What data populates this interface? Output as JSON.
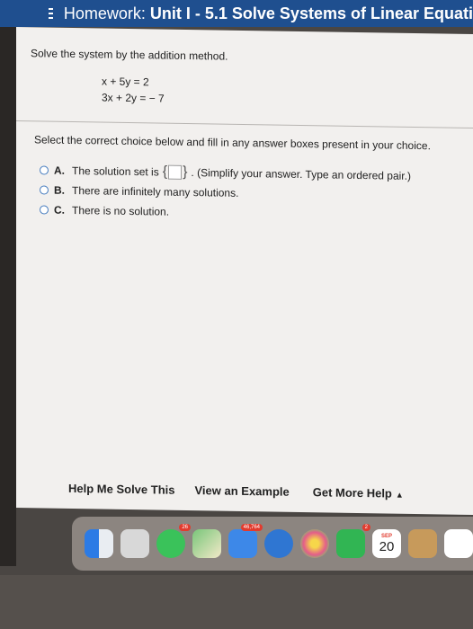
{
  "header": {
    "menu_icon": "hamburger-menu-icon",
    "title_prefix": "Homework: ",
    "title_rest": "Unit I - 5.1 Solve Systems of Linear Equati"
  },
  "question": {
    "prompt": "Solve the system by the addition method.",
    "equations": [
      "x + 5y  =  2",
      "3x + 2y  =  − 7"
    ]
  },
  "instruction": "Select the correct choice below and fill in any answer boxes present in your choice.",
  "choices": [
    {
      "letter": "A.",
      "text_before": "The solution set is",
      "text_after": ". (Simplify your answer. Type an ordered pair.)"
    },
    {
      "letter": "B.",
      "text": "There are infinitely many solutions."
    },
    {
      "letter": "C.",
      "text": "There is no solution."
    }
  ],
  "help_buttons": {
    "help_me_solve": "Help Me Solve This",
    "view_example": "View an Example",
    "get_more_help": "Get More Help",
    "caret": "▲"
  },
  "dock": {
    "apps": [
      {
        "name": "finder-icon"
      },
      {
        "name": "launchpad-icon"
      },
      {
        "name": "messages-icon",
        "badge": "26"
      },
      {
        "name": "maps-icon"
      },
      {
        "name": "mail-icon",
        "badge": "46,764"
      },
      {
        "name": "safari-icon"
      },
      {
        "name": "photos-icon"
      },
      {
        "name": "facetime-icon",
        "badge": "2"
      },
      {
        "name": "calendar-icon",
        "month": "SEP",
        "day": "20"
      },
      {
        "name": "contacts-icon"
      },
      {
        "name": "reminders-icon"
      }
    ]
  },
  "colors": {
    "header_bg": "#1f4f8f",
    "radio_border": "#4a7fc0",
    "badge": "#e23b2e"
  }
}
